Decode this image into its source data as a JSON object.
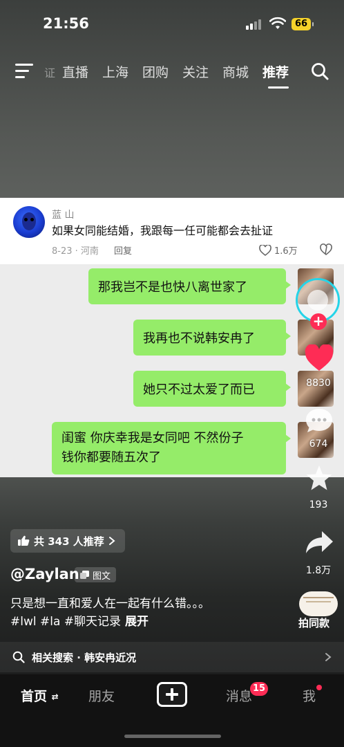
{
  "status_bar": {
    "time": "21:56",
    "battery": "66"
  },
  "top_nav": {
    "tabs": [
      "直播",
      "上海",
      "团购",
      "关注",
      "商城",
      "推荐"
    ],
    "partial_tab": "证",
    "active_tab": "推荐"
  },
  "comment": {
    "username": "蓝 山",
    "text": "如果女同能结婚，我跟每一任可能都会去扯证",
    "meta": "8-23 · 河南",
    "reply_label": "回复",
    "likes": "1.6万"
  },
  "chat": {
    "messages": [
      "那我岂不是也快八离世家了",
      "我再也不说韩安冉了",
      "她只不过太爱了而已",
      "闺蜜 你庆幸我是女同吧 不然份子",
      "钱你都要随五次了"
    ]
  },
  "actions": {
    "likes": "8830",
    "comments": "674",
    "favorites": "193",
    "shares": "1.8万",
    "sound_label": "拍同款"
  },
  "video_info": {
    "recommend_label": "共 343 人推荐",
    "author": "@Zaylan",
    "tag": "图文",
    "caption": "只是想一直和爱人在一起有什么错。。。",
    "hashtags": "#lwl #la #聊天记录",
    "expand": "展开"
  },
  "related_search": "相关搜索 · 韩安冉近况",
  "bottom_tabs": {
    "home": "首页",
    "friends": "朋友",
    "messages": "消息",
    "messages_badge": "15",
    "me": "我"
  },
  "colors": {
    "bubble_green": "#95ec69",
    "accent_red": "#fe2c55",
    "follow_ring": "#25d4e8",
    "battery_yellow": "#f5d22a"
  }
}
